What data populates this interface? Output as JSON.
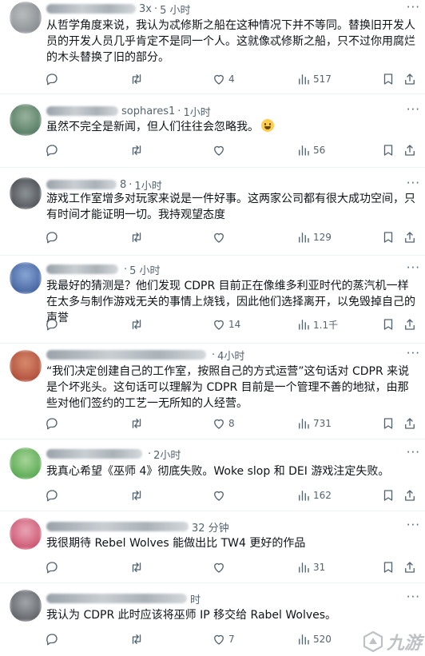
{
  "tweets": [
    {
      "handle_tail": "3x",
      "time": "5 小时",
      "text": "从哲学角度来说，我认为忒修斯之船在这种情况下并不等同。替换旧开发人员的开发人员几乎肯定不是同一个人。这就像忒修斯之船，只不过你用腐烂的木头替换了旧的部分。",
      "likes": "4",
      "views": "517",
      "avatar_colors": [
        "#7a7f84",
        "#b9bdbf"
      ]
    },
    {
      "handle_tail": "sophares1",
      "time": "1小时",
      "text": "虽然不完全是新闻，但人们往往会忽略我。",
      "likes": "",
      "views": "56",
      "avatar_colors": [
        "#3f6b4f",
        "#9bb39f"
      ]
    },
    {
      "handle_tail": "8",
      "time": "1小时",
      "text": "游戏工作室增多对玩家来说是一件好事。这两家公司都有很大成功空间，只有时间才能证明一切。我持观望态度",
      "likes": "",
      "views": "129",
      "avatar_colors": [
        "#3c3f44",
        "#8f9499"
      ]
    },
    {
      "handle_tail": "",
      "time": "5 小时",
      "text": "我最好的猜测是？他们发现 CDPR 目前正在像维多利亚时代的蒸汽机一样在太多与制作游戏无关的事情上烧钱，因此他们选择离开，以免毁掉自己的声誉",
      "likes": "14",
      "views": "1.1千",
      "avatar_colors": [
        "#2f4f8f",
        "#8aa6d6"
      ]
    },
    {
      "handle_tail": "",
      "time": "4小时",
      "text": "“我们决定创建自己的工作室，按照自己的方式运营”这句话对 CDPR 来说是个坏兆头。这句话可以理解为 CDPR 目前是一个管理不善的地狱，由那些对他们签约的工艺一无所知的人经营。",
      "likes": "8",
      "views": "731",
      "avatar_colors": [
        "#a33a2a",
        "#d98c6e"
      ]
    },
    {
      "handle_tail": "",
      "time": "2小时",
      "text": "我真心希望《巫师 4》彻底失败。Woke slop 和 DEI 游戏注定失败。",
      "likes": "",
      "views": "162",
      "avatar_colors": [
        "#3f9a3a",
        "#a9d69b"
      ]
    },
    {
      "handle_tail": "",
      "time": "32 分钟",
      "text": "我很期待 Rebel Wolves 能做出比 TW4 更好的作品",
      "likes": "",
      "views": "31",
      "avatar_colors": [
        "#c23a5a",
        "#e9a7b6"
      ]
    },
    {
      "handle_tail": "",
      "time": "时",
      "text": "我认为 CDPR 此时应该将巫师 IP 移交给 Rabel Wolves。",
      "likes": "7",
      "views": "520",
      "avatar_colors": [
        "#4a4d52",
        "#a5a9ad"
      ]
    }
  ],
  "icons": {
    "reply": "reply-icon",
    "retweet": "retweet-icon",
    "like": "heart-icon",
    "views": "views-icon",
    "bookmark": "bookmark-icon",
    "share": "share-icon"
  },
  "watermark_text": "九游",
  "colors": {
    "secondary_text": "#536471",
    "primary_text": "#0f1419",
    "divider": "#eff3f4"
  }
}
